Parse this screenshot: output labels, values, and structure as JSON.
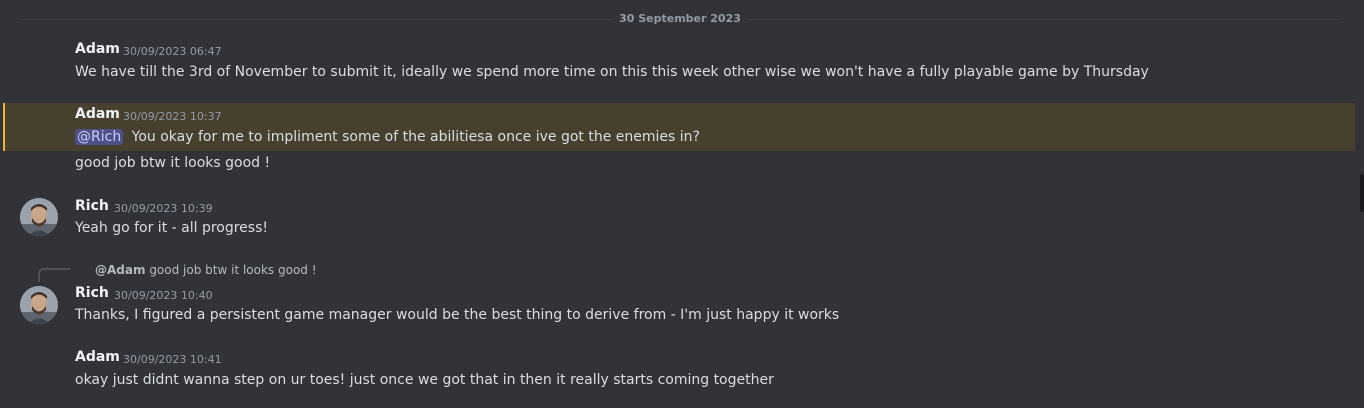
{
  "date_divider": "30 September 2023",
  "messages": {
    "m1": {
      "author": "Adam",
      "timestamp": "30/09/2023 06:47",
      "text": "We have till the 3rd of November to submit it, ideally we spend more time on this this week other wise we won't have a fully playable game by Thursday"
    },
    "m2": {
      "author": "Adam",
      "timestamp": "30/09/2023 10:37",
      "mention": "@Rich",
      "text": "You okay for me to impliment some of the abilitiesa once ive got the enemies in?",
      "followup": "good job btw it looks good !"
    },
    "m3": {
      "author": "Rich",
      "timestamp": "30/09/2023 10:39",
      "text": "Yeah go for it - all progress!"
    },
    "m4": {
      "reply_author": "@Adam",
      "reply_text": "good job btw it looks good !",
      "author": "Rich",
      "timestamp": "30/09/2023 10:40",
      "text": "Thanks, I figured a persistent game manager would be the best thing to derive from - I'm just happy it works"
    },
    "m5": {
      "author": "Adam",
      "timestamp": "30/09/2023 10:41",
      "text": "okay just didnt wanna step on ur toes! just once we got that in then it really starts coming together"
    }
  },
  "colors": {
    "background": "#313338",
    "mention_highlight": "#48402f",
    "mention_bar": "#f0b232",
    "mention_pill": "#4c5187"
  }
}
